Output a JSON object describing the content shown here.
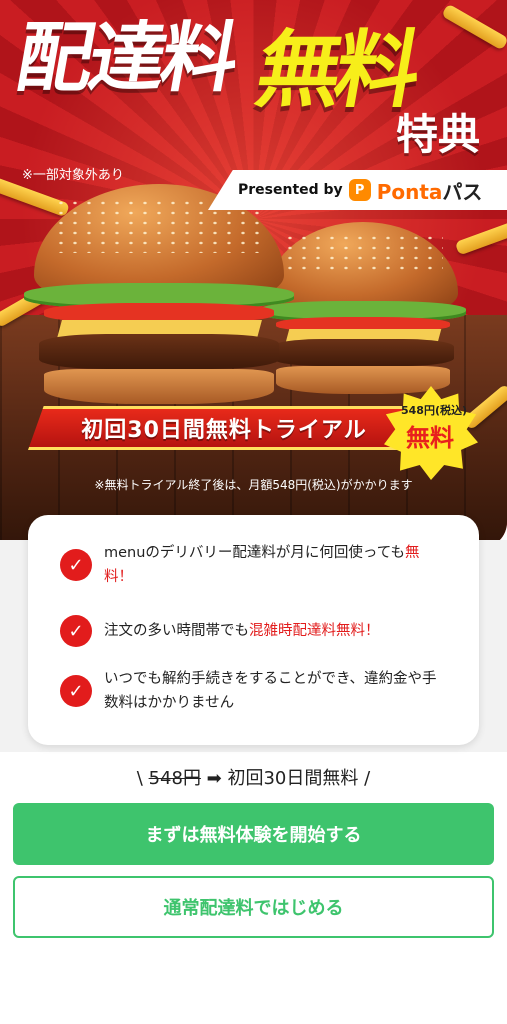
{
  "hero": {
    "title_part1": "配達料",
    "title_part2": "無料",
    "title_part3": "特典",
    "excluded_note": "※一部対象外あり",
    "presented_by": "Presented by",
    "brand_icon_char": "P",
    "brand_name": "Ponta",
    "brand_kana": "パス",
    "trial_banner": "初回30日間無料トライアル",
    "burst_price": "548円(税込)",
    "burst_free": "無料",
    "after_trial_note": "※無料トライアル終了後は、月額548円(税込)がかかります"
  },
  "features": [
    {
      "text_before": "menuのデリバリー配達料が月に何回使っても",
      "text_red": "無料！",
      "text_after": ""
    },
    {
      "text_before": "注文の多い時間帯でも",
      "text_red": "混雑時配達料無料！",
      "text_after": ""
    },
    {
      "text_before": "いつでも解約手続きをすることができ、違約金や手数料はかかりません",
      "text_red": "",
      "text_after": ""
    }
  ],
  "pricing": {
    "prefix": "\\ ",
    "old_price": "548円",
    "arrow": " ➡ ",
    "new_text": "初回30日間無料",
    "suffix": " /"
  },
  "buttons": {
    "primary_label": "まずは無料体験を開始する",
    "secondary_label": "通常配達料ではじめる"
  },
  "colors": {
    "hero_red": "#c91d22",
    "accent_yellow": "#f7ee1a",
    "check_red": "#e21c1c",
    "cta_green": "#3ec46d"
  },
  "icons": {
    "check": "check-circle-icon",
    "brand": "ponta-icon"
  }
}
